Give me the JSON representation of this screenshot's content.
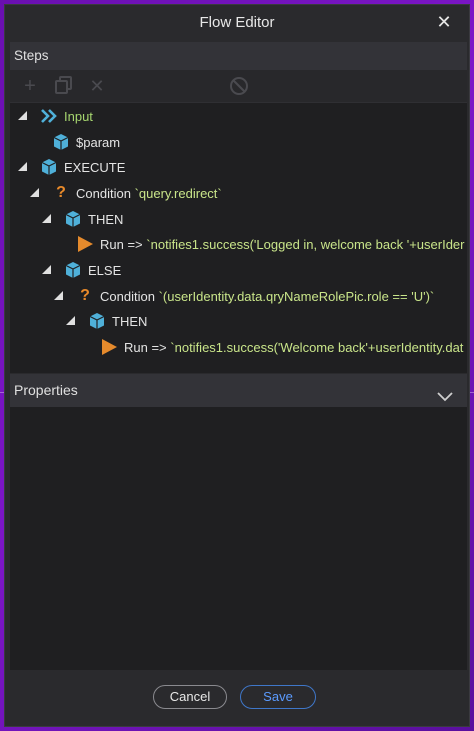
{
  "window": {
    "title": "Flow Editor"
  },
  "steps": {
    "header": "Steps",
    "tree": [
      {
        "key": "input",
        "label": "Input",
        "icon": "chevrons-right-icon"
      },
      {
        "key": "param",
        "label": "$param",
        "icon": "cube-icon"
      },
      {
        "key": "execute",
        "label": "EXECUTE",
        "icon": "cube-icon"
      },
      {
        "key": "cond1",
        "label_key": "Condition",
        "label_value": "`query.redirect`",
        "icon": "question-icon"
      },
      {
        "key": "then1",
        "label": "THEN",
        "icon": "cube-icon"
      },
      {
        "key": "run1",
        "label_key": "Run =>",
        "label_value": "`notifies1.success('Logged in, welcome back '+userIder",
        "icon": "play-icon"
      },
      {
        "key": "else1",
        "label": "ELSE",
        "icon": "cube-icon"
      },
      {
        "key": "cond2",
        "label_key": "Condition",
        "label_value": "`(userIdentity.data.qryNameRolePic.role == 'U')`",
        "icon": "question-icon"
      },
      {
        "key": "then2",
        "label": "THEN",
        "icon": "cube-icon"
      },
      {
        "key": "run2",
        "label_key": "Run =>",
        "label_value": "`notifies1.success('Welcome back'+userIdentity.dat",
        "icon": "play-icon"
      }
    ]
  },
  "properties": {
    "header": "Properties"
  },
  "footer": {
    "cancel_label": "Cancel",
    "save_label": "Save"
  },
  "colors": {
    "accent": "#5b9bff",
    "cube": "#4fb0d9",
    "question": "#e98a2a",
    "play": "#e58a2c",
    "input_green": "#a6d66f"
  }
}
